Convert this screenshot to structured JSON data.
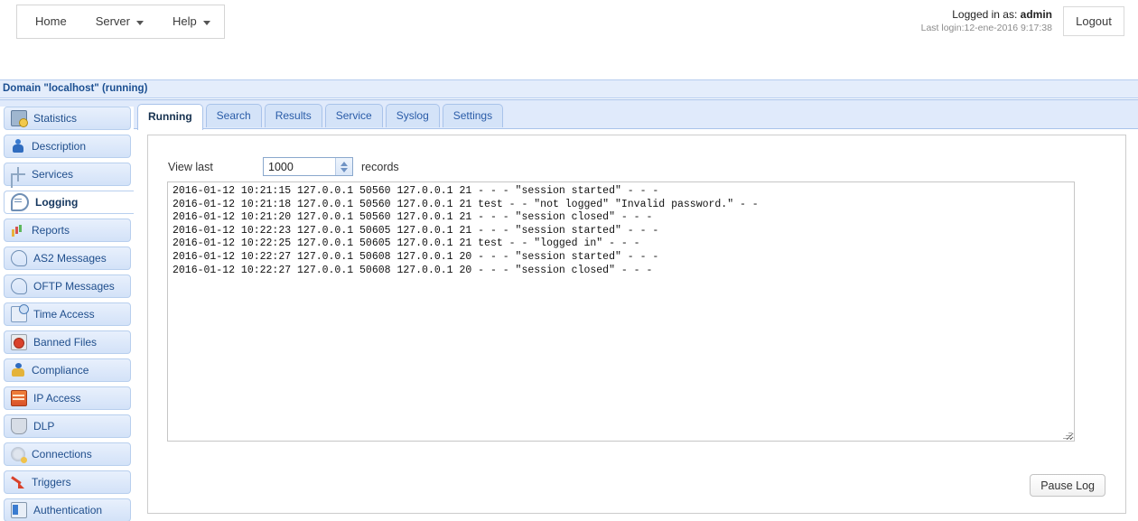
{
  "topbar": {
    "nav": [
      {
        "label": "Home",
        "has_caret": false,
        "icon": null
      },
      {
        "label": "Server",
        "has_caret": true,
        "icon": "chevron-down-icon"
      },
      {
        "label": "Help",
        "has_caret": true,
        "icon": "chevron-down-icon"
      }
    ],
    "logged_in_prefix": "Logged in as: ",
    "logged_in_user": "admin",
    "last_login": "Last login:12-ene-2016 9:17:38",
    "logout_label": "Logout"
  },
  "domain": {
    "title": "Domain \"localhost\" (running)"
  },
  "tabs": [
    {
      "label": "Running",
      "active": true
    },
    {
      "label": "Search",
      "active": false
    },
    {
      "label": "Results",
      "active": false
    },
    {
      "label": "Service",
      "active": false
    },
    {
      "label": "Syslog",
      "active": false
    },
    {
      "label": "Settings",
      "active": false
    }
  ],
  "sidebar": {
    "items": [
      {
        "label": "Statistics",
        "icon": "statistics-icon",
        "icon_class": "ic-stat",
        "active": false
      },
      {
        "label": "Description",
        "icon": "description-icon",
        "icon_class": "ic-desc",
        "active": false
      },
      {
        "label": "Services",
        "icon": "services-icon",
        "icon_class": "ic-serv",
        "active": false
      },
      {
        "label": "Logging",
        "icon": "logging-icon",
        "icon_class": "ic-log",
        "active": true
      },
      {
        "label": "Reports",
        "icon": "reports-icon",
        "icon_class": "ic-rep",
        "active": false
      },
      {
        "label": "AS2 Messages",
        "icon": "as2-messages-icon",
        "icon_class": "ic-msg",
        "active": false
      },
      {
        "label": "OFTP Messages",
        "icon": "oftp-messages-icon",
        "icon_class": "ic-msg",
        "active": false
      },
      {
        "label": "Time Access",
        "icon": "time-access-icon",
        "icon_class": "ic-time",
        "active": false
      },
      {
        "label": "Banned Files",
        "icon": "banned-files-icon",
        "icon_class": "ic-ban",
        "active": false
      },
      {
        "label": "Compliance",
        "icon": "compliance-icon",
        "icon_class": "ic-comp",
        "active": false
      },
      {
        "label": "IP Access",
        "icon": "ip-access-icon",
        "icon_class": "ic-ip",
        "active": false
      },
      {
        "label": "DLP",
        "icon": "dlp-icon",
        "icon_class": "ic-dlp",
        "active": false
      },
      {
        "label": "Connections",
        "icon": "connections-icon",
        "icon_class": "ic-conn",
        "active": false
      },
      {
        "label": "Triggers",
        "icon": "triggers-icon",
        "icon_class": "ic-trig",
        "active": false
      },
      {
        "label": "Authentication",
        "icon": "authentication-icon",
        "icon_class": "ic-auth",
        "active": false
      }
    ]
  },
  "main": {
    "view_last_label": "View last",
    "records_count": "1000",
    "records_label": "records",
    "pause_log_label": "Pause Log",
    "log_lines": [
      "2016-01-12 10:21:15 127.0.0.1 50560 127.0.0.1 21 - - - \"session started\" - - -",
      "2016-01-12 10:21:18 127.0.0.1 50560 127.0.0.1 21 test - - \"not logged\" \"Invalid password.\" - -",
      "2016-01-12 10:21:20 127.0.0.1 50560 127.0.0.1 21 - - - \"session closed\" - - -",
      "2016-01-12 10:22:23 127.0.0.1 50605 127.0.0.1 21 - - - \"session started\" - - -",
      "2016-01-12 10:22:25 127.0.0.1 50605 127.0.0.1 21 test - - \"logged in\" - - -",
      "2016-01-12 10:22:27 127.0.0.1 50608 127.0.0.1 20 - - - \"session started\" - - -",
      "2016-01-12 10:22:27 127.0.0.1 50608 127.0.0.1 20 - - - \"session closed\" - - -"
    ]
  },
  "colors": {
    "band_bg": "#e4edfb",
    "tabstrip_bg": "#e0eafb",
    "link_blue": "#1f4e8c",
    "title_blue": "#1b4f91"
  }
}
